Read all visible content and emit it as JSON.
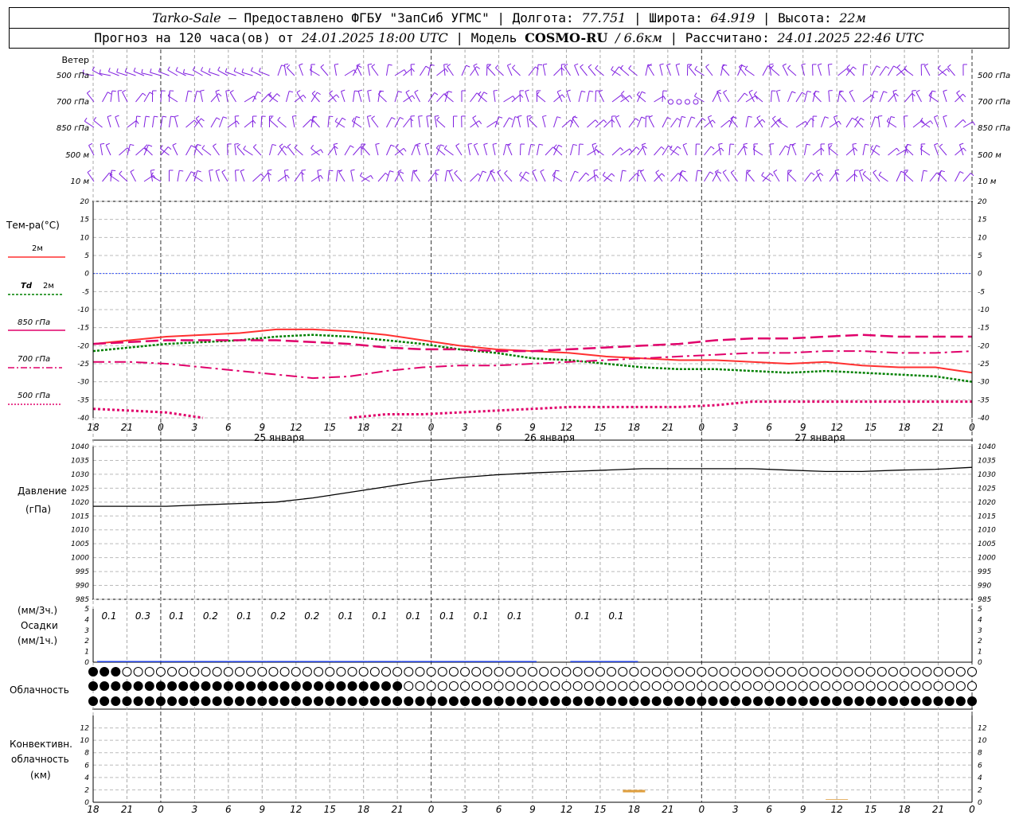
{
  "header": {
    "station": "Tarko-Sale",
    "provider": "Предоставлено ФГБУ \"ЗапСиб УГМС\"",
    "lon_label": "Долгота:",
    "lon": "77.751",
    "lat_label": "Широта:",
    "lat": "64.919",
    "alt_label": "Высота:",
    "alt": "22м",
    "forecast_prefix": "Прогноз на 120 часа(ов) от",
    "forecast_start": "24.01.2025 18:00 UTC",
    "model_label": "Модель",
    "model": "COSMO-RU",
    "resolution": "6.6км",
    "computed_label": "Рассчитано:",
    "computed": "24.01.2025 22:46 UTC"
  },
  "labels": {
    "wind": "Ветер",
    "wind_levels": [
      "500 гПа",
      "700 гПа",
      "850 гПа",
      "500 м",
      "10  м"
    ],
    "temp": "Тем-ра(°С)",
    "t2m": "2м",
    "td": "Td",
    "td2m": "2м",
    "t850": "850 гПа",
    "t700": "700 гПа",
    "t500": "500 гПа",
    "pressure": "Давление",
    "pressure_unit": "(гПа)",
    "precip_unit1": "(мм/3ч.)",
    "precip": "Осадки",
    "precip_unit2": "(мм/1ч.)",
    "cloud": "Облачность",
    "conv1": "Конвективн.",
    "conv2": "облачность",
    "conv3": "(км)"
  },
  "chart_data": {
    "type": "line",
    "x_ticks": [
      "18",
      "21",
      "0",
      "3",
      "6",
      "9",
      "12",
      "15",
      "18",
      "21",
      "0",
      "3",
      "6",
      "9",
      "12",
      "15",
      "18",
      "21",
      "0",
      "3",
      "6",
      "9",
      "12",
      "15",
      "18",
      "21",
      "0"
    ],
    "date_labels": [
      "25 января",
      "26 января",
      "27 января"
    ],
    "temperature": {
      "ylim": [
        -40,
        20
      ],
      "yticks": [
        20,
        15,
        10,
        5,
        0,
        -5,
        -10,
        -15,
        -20,
        -25,
        -30,
        -35,
        -40
      ],
      "series": [
        {
          "name": "2м",
          "color": "#ff3030",
          "values": [
            -19.5,
            -18.5,
            -17.5,
            -17,
            -16.5,
            -15.5,
            -15.5,
            -16,
            -17,
            -18.5,
            -20,
            -21,
            -21.5,
            -22,
            -23,
            -23.5,
            -24,
            -24,
            -24.5,
            -25,
            -24.5,
            -25.5,
            -26,
            -26,
            -27.5
          ]
        },
        {
          "name": "Td 2м",
          "color": "#008000",
          "values": [
            -21.5,
            -20.5,
            -19.5,
            -19,
            -18.5,
            -17.5,
            -17,
            -17.5,
            -18.5,
            -19.5,
            -21,
            -22,
            -23.5,
            -24,
            -25,
            -26,
            -26.5,
            -26.5,
            -27,
            -27.5,
            -27,
            -27.5,
            -28,
            -28.5,
            -30
          ]
        },
        {
          "name": "850 гПа",
          "color": "#e0006a",
          "values": [
            -19.5,
            -19,
            -18.5,
            -18.5,
            -18.5,
            -18.5,
            -19,
            -19.5,
            -20.5,
            -21,
            -21,
            -21.5,
            -21.5,
            -21,
            -20.5,
            -20,
            -19.5,
            -18.5,
            -18,
            -18,
            -17.5,
            -17,
            -17.5,
            -17.5,
            -17.5
          ]
        },
        {
          "name": "700 гПа",
          "color": "#e0006a",
          "values": [
            -24.5,
            -24.5,
            -25,
            -26,
            -27,
            -28,
            -29,
            -28.5,
            -27,
            -26,
            -25.5,
            -25.5,
            -25,
            -24.5,
            -24,
            -23.5,
            -23,
            -22.5,
            -22,
            -22,
            -21.5,
            -21.5,
            -22,
            -22,
            -21.5
          ]
        },
        {
          "name": "500 гПа",
          "color": "#e0006a",
          "values": [
            -37.5,
            -38,
            -38.5,
            -40,
            null,
            null,
            null,
            -40,
            -39,
            -39,
            -38.5,
            -38,
            -37.5,
            -37,
            -37,
            -37,
            -37,
            -36.5,
            -35.5,
            -35.5,
            -35.5,
            -35.5,
            -35.5,
            -35.5,
            -35.5
          ]
        }
      ]
    },
    "pressure": {
      "ylim": [
        985,
        1040
      ],
      "yticks": [
        1040,
        1035,
        1030,
        1025,
        1020,
        1015,
        1010,
        1005,
        1000,
        995,
        990,
        985
      ],
      "values": [
        1018.5,
        1018.5,
        1018.5,
        1019,
        1019.5,
        1020,
        1021.5,
        1023.5,
        1025.5,
        1027.5,
        1028.8,
        1029.8,
        1030.5,
        1031,
        1031.5,
        1032,
        1032,
        1032,
        1032,
        1031.5,
        1031,
        1031,
        1031.5,
        1031.8,
        1032.5
      ]
    },
    "precipitation": {
      "ylim": [
        0,
        5
      ],
      "yticks": [
        5,
        4,
        3,
        2,
        1,
        0
      ],
      "labels_3h": [
        "0.1",
        "0.3",
        "0.1",
        "0.2",
        "0.1",
        "0.2",
        "0.2",
        "0.1",
        "0.1",
        "0.1",
        "0.1",
        "0.1",
        "0.1",
        "",
        "0.1",
        "0.1"
      ]
    },
    "convective": {
      "ylim": [
        0,
        14
      ],
      "yticks": [
        12,
        10,
        8,
        6,
        4,
        2,
        0
      ],
      "bars": [
        {
          "t": 48,
          "top": 2.0
        },
        {
          "t": 66,
          "top": 0.5
        },
        {
          "t": 90,
          "top": 0.5
        },
        {
          "t": 105,
          "top": 0.5
        }
      ]
    }
  }
}
